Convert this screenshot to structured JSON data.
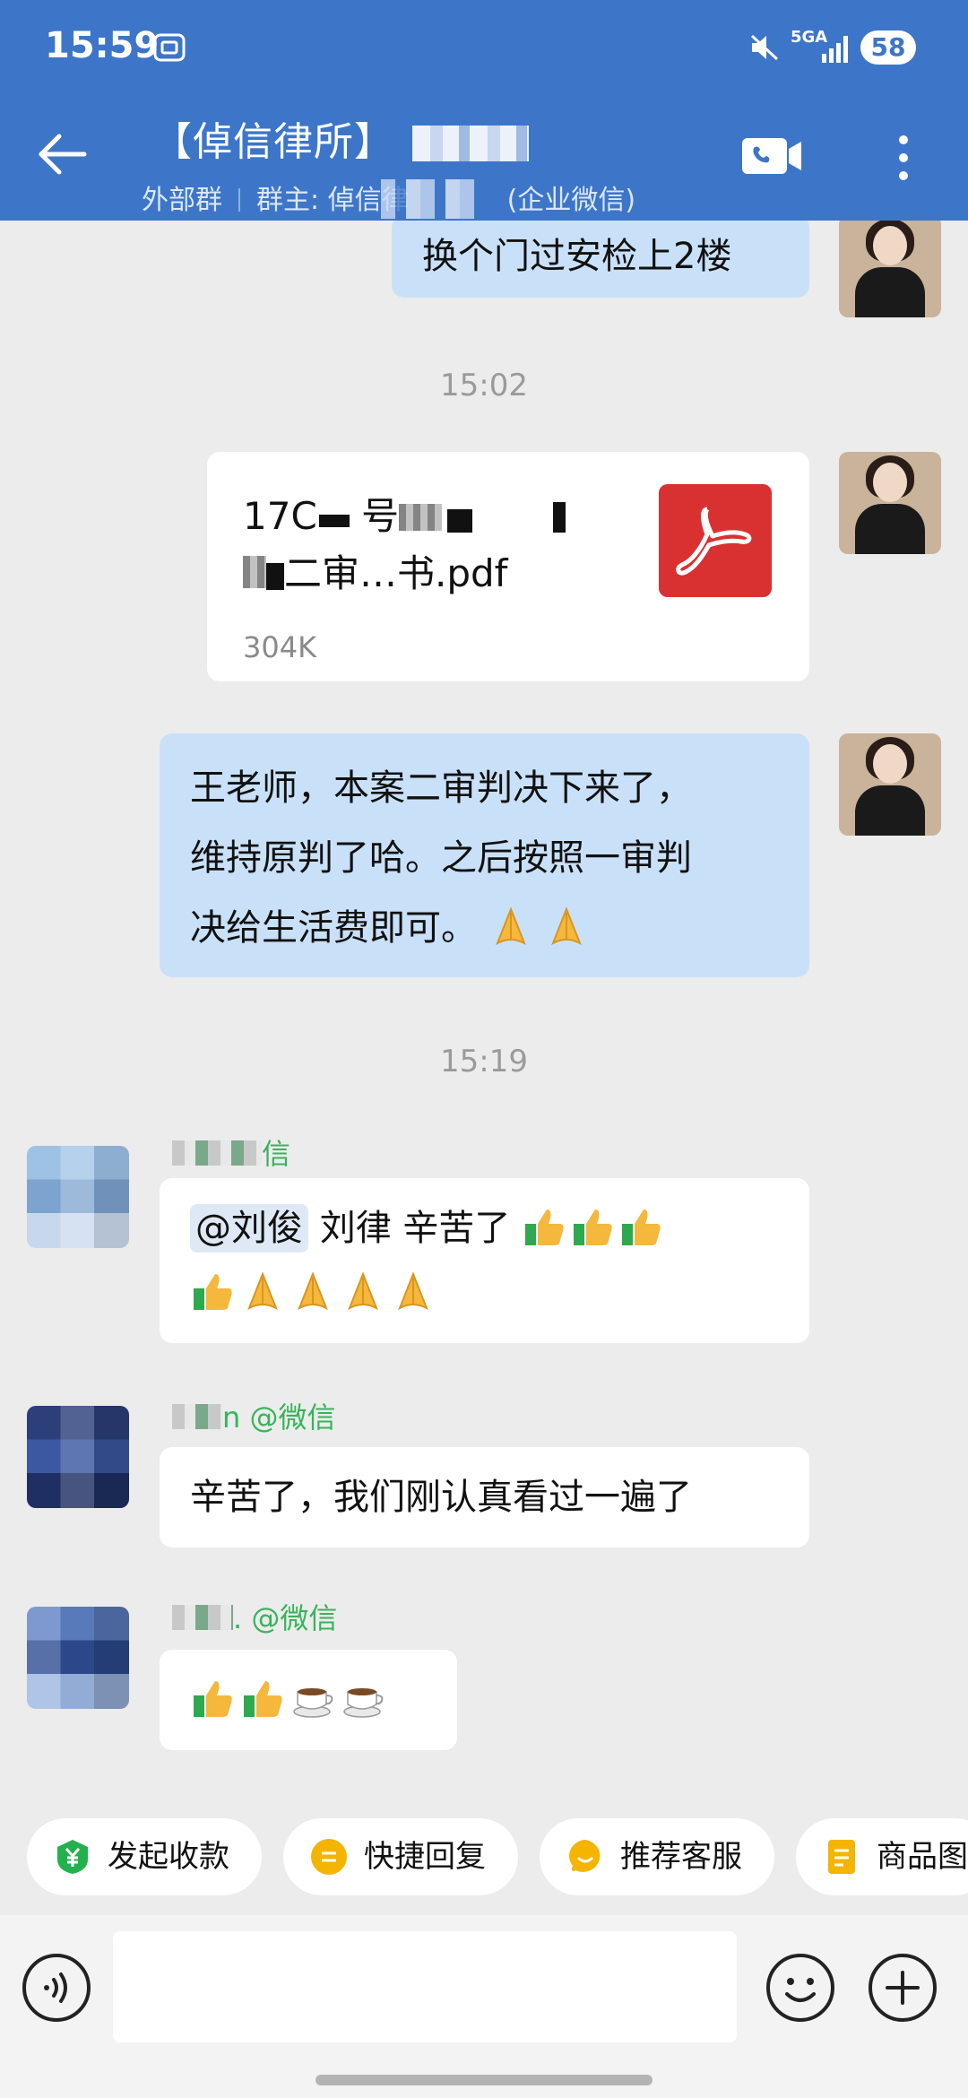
{
  "status_bar": {
    "time": "15:59",
    "network": "5GA",
    "battery": "58"
  },
  "header": {
    "title": "【倬信律所】",
    "subtitle_external": "外部群",
    "subtitle_owner": "群主: 倬信律",
    "subtitle_corp": "(企业微信)"
  },
  "messages": {
    "m1_text": "换个门过安检上2楼",
    "time1": "15:02",
    "file_line1": "17C",
    "file_line1_b": "号",
    "file_line2": "二审…书.pdf",
    "file_size": "304K",
    "m3_line1": "王老师，本案二审判决下来了，",
    "m3_line2": "维持原判了哈。之后按照一审判",
    "m3_line3": "决给生活费即可。",
    "time2": "15:19",
    "sender1_suffix": "信",
    "m4_mention": "@刘俊",
    "m4_text": " 刘律 辛苦了 ",
    "sender2_suffix": "n @微信",
    "m5_text": "辛苦了，我们刚认真看过一遍了",
    "sender3_suffix": ". @微信"
  },
  "quick_replies": [
    {
      "label": "发起收款",
      "icon": "yuan-icon",
      "color": "#23b14d"
    },
    {
      "label": "快捷回复",
      "icon": "quick-reply-icon",
      "color": "#f4b400"
    },
    {
      "label": "推荐客服",
      "icon": "service-icon",
      "color": "#f4b400"
    },
    {
      "label": "商品图",
      "icon": "goods-icon",
      "color": "#f4b400"
    }
  ],
  "colors": {
    "header": "#3d76c9",
    "my_bubble": "#c9e1f8",
    "wechat_green": "#38b35b",
    "pdf_red": "#d93131"
  }
}
